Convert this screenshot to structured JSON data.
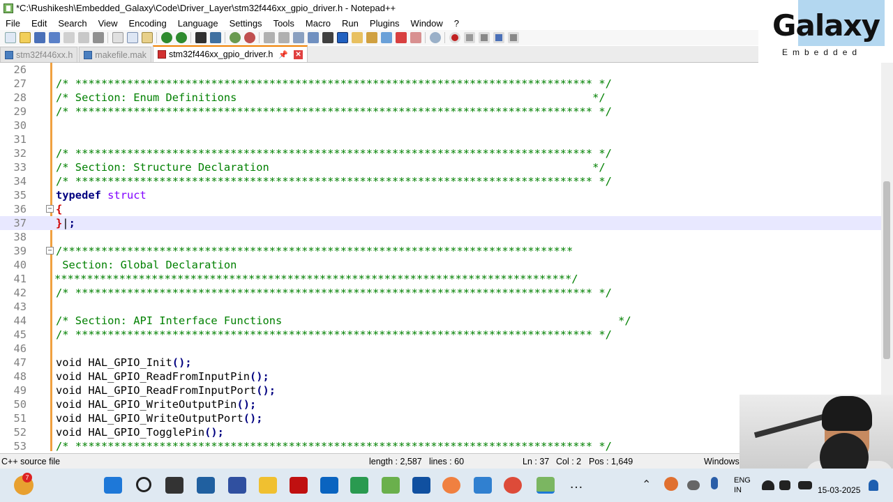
{
  "window": {
    "title": "*C:\\Rushikesh\\Embedded_Galaxy\\Code\\Driver_Layer\\stm32f446xx_gpio_driver.h - Notepad++"
  },
  "menu": [
    "File",
    "Edit",
    "Search",
    "View",
    "Encoding",
    "Language",
    "Settings",
    "Tools",
    "Macro",
    "Run",
    "Plugins",
    "Window",
    "?"
  ],
  "tabs": [
    {
      "label": "stm32f446xx.h",
      "active": false
    },
    {
      "label": "makefile.mak",
      "active": false
    },
    {
      "label": "stm32f446xx_gpio_driver.h",
      "active": true
    }
  ],
  "logo": {
    "word": "Galaxy",
    "sub": "Embedded"
  },
  "editor": {
    "current_line": 37,
    "lines": [
      {
        "n": "26",
        "t": ""
      },
      {
        "n": "27",
        "t": "/* ******************************************************************************** */"
      },
      {
        "n": "28",
        "t": "/* Section: Enum Definitions                                                       */"
      },
      {
        "n": "29",
        "t": "/* ******************************************************************************** */"
      },
      {
        "n": "30",
        "t": ""
      },
      {
        "n": "31",
        "t": ""
      },
      {
        "n": "32",
        "t": "/* ******************************************************************************** */"
      },
      {
        "n": "33",
        "t": "/* Section: Structure Declaration                                                  */"
      },
      {
        "n": "34",
        "t": "/* ******************************************************************************** */"
      },
      {
        "n": "35",
        "t": "typedef struct"
      },
      {
        "n": "36",
        "t": "{"
      },
      {
        "n": "37",
        "t": "};"
      },
      {
        "n": "38",
        "t": ""
      },
      {
        "n": "39",
        "t": "/*******************************************************************************"
      },
      {
        "n": "40",
        "t": " Section: Global Declaration"
      },
      {
        "n": "41",
        "t": "********************************************************************************/"
      },
      {
        "n": "42",
        "t": "/* ******************************************************************************** */"
      },
      {
        "n": "43",
        "t": ""
      },
      {
        "n": "44",
        "t": "/* Section: API Interface Functions                                                    */"
      },
      {
        "n": "45",
        "t": "/* ******************************************************************************** */"
      },
      {
        "n": "46",
        "t": ""
      },
      {
        "n": "47",
        "t": "void HAL_GPIO_Init();"
      },
      {
        "n": "48",
        "t": "void HAL_GPIO_ReadFromInputPin();"
      },
      {
        "n": "49",
        "t": "void HAL_GPIO_ReadFromInputPort();"
      },
      {
        "n": "50",
        "t": "void HAL_GPIO_WriteOutputPin();"
      },
      {
        "n": "51",
        "t": "void HAL_GPIO_WriteOutputPort();"
      },
      {
        "n": "52",
        "t": "void HAL_GPIO_TogglePin();"
      },
      {
        "n": "53",
        "t": "/* ******************************************************************************** */"
      }
    ]
  },
  "status": {
    "filetype": "C++ source file",
    "length": "length : 2,587",
    "lines": "lines : 60",
    "ln": "Ln : 37",
    "col": "Col : 2",
    "pos": "Pos : 1,649",
    "eol": "Windows"
  },
  "taskbar": {
    "weather_badge": "7",
    "lang1": "ENG",
    "lang2": "IN",
    "date": "15-03-2025"
  },
  "colors": {
    "comment": "#008000",
    "keyword": "#000080",
    "type": "#8000ff",
    "brace": "#d00000",
    "accent": "#f08000"
  }
}
